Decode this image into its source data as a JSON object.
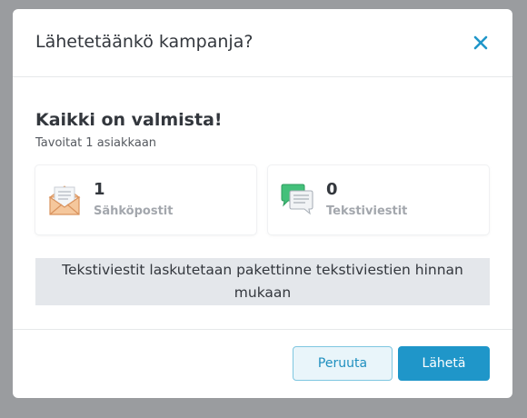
{
  "dialog": {
    "title": "Lähetetäänkö kampanja?",
    "heading": "Kaikki on valmista!",
    "subheading": "Tavoitat 1 asiakkaan",
    "stats": {
      "email": {
        "value": "1",
        "label": "Sähköpostit",
        "icon": "envelope-icon"
      },
      "sms": {
        "value": "0",
        "label": "Tekstiviestit",
        "icon": "chat-bubbles-icon"
      }
    },
    "notice": "Tekstiviestit laskutetaan pakettinne tekstiviestien hinnan mukaan",
    "buttons": {
      "cancel": "Peruuta",
      "send": "Lähetä"
    },
    "colors": {
      "accent": "#1f96c9",
      "overlay": "#9a9c9f"
    }
  }
}
